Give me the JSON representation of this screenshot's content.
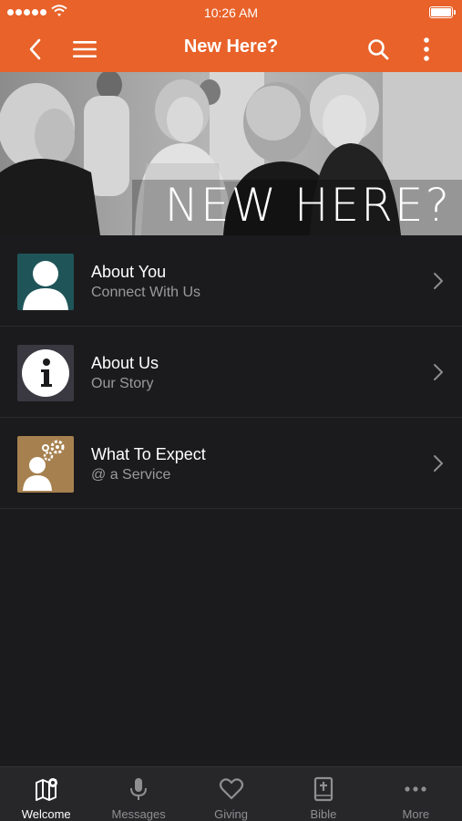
{
  "status": {
    "time": "10:26 AM"
  },
  "header": {
    "title": "New Here?"
  },
  "hero": {
    "text": "NEW HERE?"
  },
  "items": [
    {
      "title": "About You",
      "subtitle": "Connect With Us",
      "icon": "person-icon",
      "thumb_color": "#1f5559"
    },
    {
      "title": "About Us",
      "subtitle": "Our Story",
      "icon": "info-icon",
      "thumb_color": "#3a3840"
    },
    {
      "title": "What To Expect",
      "subtitle": "@ a Service",
      "icon": "person-gears-icon",
      "thumb_color": "#a6814f"
    }
  ],
  "tabs": [
    {
      "label": "Welcome",
      "icon": "map-pin-icon",
      "active": true
    },
    {
      "label": "Messages",
      "icon": "microphone-icon",
      "active": false
    },
    {
      "label": "Giving",
      "icon": "heart-icon",
      "active": false
    },
    {
      "label": "Bible",
      "icon": "bible-icon",
      "active": false
    },
    {
      "label": "More",
      "icon": "more-dots-icon",
      "active": false
    }
  ],
  "colors": {
    "accent": "#e8622a",
    "background": "#1b1b1d",
    "tabbar": "#27272a"
  }
}
